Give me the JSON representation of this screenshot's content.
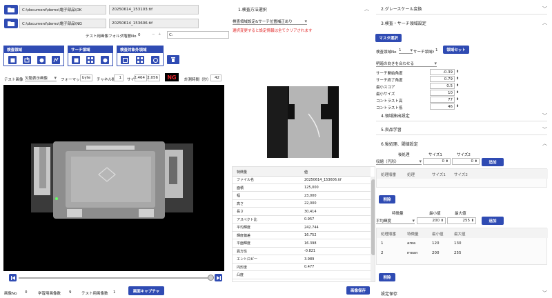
{
  "files": [
    {
      "path": "C:\\document\\demo\\電子部品\\OK",
      "name": "20250614_153103.tif"
    },
    {
      "path": "C:\\document\\demo\\電子部品\\NG",
      "name": "20250614_153606.tif"
    }
  ],
  "test_folder": {
    "label": "テスト用画像フォルダ階層No",
    "value": "0",
    "minus": "−",
    "plus": "+",
    "prefix": "C:"
  },
  "groups": {
    "inspect": "検査領域",
    "search": "サーチ領域",
    "exclude": "検査対象外領域"
  },
  "image_bar": {
    "test_image_label": "テスト画像",
    "mode": "欠陥表示画像",
    "format_label": "フォーマット",
    "format": "byte",
    "channel_label": "チャネル数",
    "channel": "1",
    "size_label": "サイズ",
    "width": "2,464",
    "height": "2,056",
    "result": "NG",
    "time_label": "計測時間（秒）",
    "time": "42"
  },
  "footer": {
    "image_no_label": "画像No",
    "image_no": "0",
    "train_count_label": "学習用画像数",
    "train_count": "9",
    "test_count_label": "テスト用画像数",
    "test_count": "1",
    "capture_btn": "画面キャプチャ"
  },
  "method": {
    "title": "1.検査方法選択",
    "combo": "検査領域設定&サーチ位置補正あり",
    "warning": "選択変更すると設定情報は全てクリアされます"
  },
  "table": {
    "col1": "特徴量",
    "col2": "値",
    "rows": [
      [
        "ファイル名",
        "20250614_153606.tif"
      ],
      [
        "面積",
        "125,000"
      ],
      [
        "幅",
        "23,000"
      ],
      [
        "高さ",
        "22,000"
      ],
      [
        "長さ",
        "30,414"
      ],
      [
        "アスペクト比",
        "0.957"
      ],
      [
        "平均輝度",
        "242.744"
      ],
      [
        "輝度偏差",
        "16.752"
      ],
      [
        "平面輝度",
        "16.398"
      ],
      [
        "異方性",
        "-0.821"
      ],
      [
        "エントロピー",
        "3.989"
      ],
      [
        "円形度",
        "0.477"
      ],
      [
        "凸度",
        ""
      ]
    ],
    "save_btn": "画像保存"
  },
  "grayscale": {
    "title": "2.グレースケール変換"
  },
  "search_setup": {
    "title": "3.検査・サーチ領域設定",
    "master_btn": "マスタ選択",
    "area_label": "検査領域No",
    "area_value": "1",
    "search_label": "サーチ領域No",
    "search_value": "1",
    "set_btn": "領域セット",
    "align": "明暗の向きを合わせる",
    "params": [
      {
        "label": "サーチ開始角度",
        "value": "-0.39"
      },
      {
        "label": "サーチ終了角度",
        "value": "0.79"
      },
      {
        "label": "最小スコア",
        "value": "0.5"
      },
      {
        "label": "最小サイズ",
        "value": "10"
      },
      {
        "label": "コントラスト高",
        "value": "77"
      },
      {
        "label": "コントラスト低",
        "value": "46"
      }
    ]
  },
  "sec4": "4.領域抽出設定",
  "sec5": "5.良品学習",
  "post": {
    "title": "6.後処理、閾値設定",
    "pp_label": "後処理",
    "size1_label": "サイズ1",
    "size2_label": "サイズ2",
    "pp_value": "収縮（円形）",
    "size1": "0",
    "size2": "0",
    "add_btn": "追加",
    "grid1_headers": [
      "処理順番",
      "処理",
      "サイズ1",
      "サイズ2"
    ],
    "delete_btn": "削除",
    "feat_label": "特徴量",
    "min_label": "最小値",
    "max_label": "最大値",
    "feat_value": "平均輝度",
    "min_value": "200",
    "max_value": "255",
    "add2_btn": "追加",
    "grid2_headers": [
      "処理順番",
      "特徴量",
      "最小値",
      "最大値"
    ],
    "grid2_rows": [
      [
        "1",
        "area",
        "120",
        "130"
      ],
      [
        "2",
        "mean",
        "200",
        "255"
      ]
    ],
    "delete2_btn": "削除"
  },
  "sec7": "設定保存"
}
